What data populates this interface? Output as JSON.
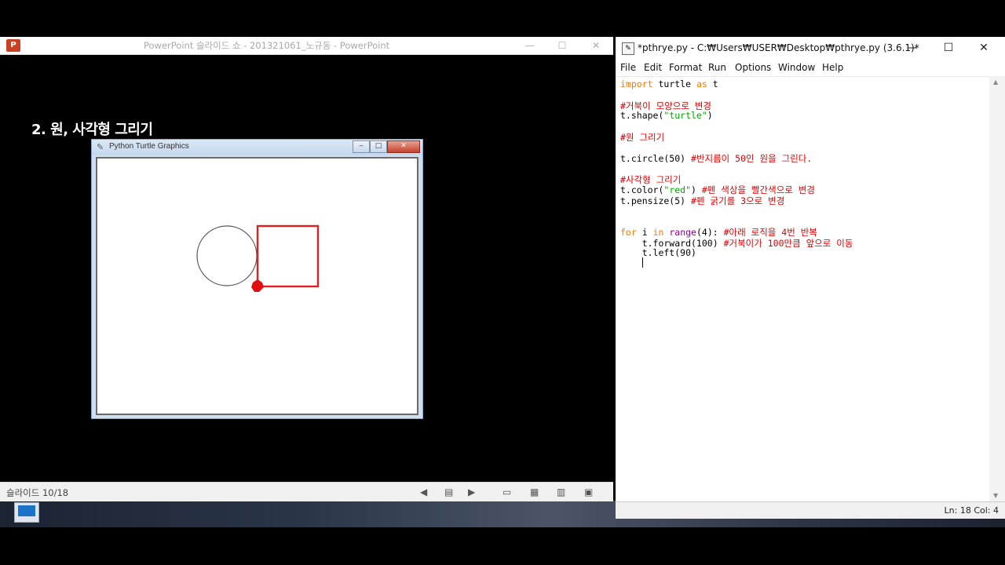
{
  "powerpoint": {
    "title": "PowerPoint 슬라이드 쇼  -  201321061_노규동 - PowerPoint",
    "logo": "P",
    "slide_heading": "2. 원, 사각형 그리기",
    "status": {
      "slide_count": "슬라이드 10/18"
    }
  },
  "turtle_window": {
    "title": "Python Turtle Graphics",
    "drawing": {
      "circle_color": "#555555",
      "square_color": "#ff0000",
      "turtle_color": "#ff0000"
    }
  },
  "idle": {
    "title": "*pthrye.py - C:₩Users₩USER₩Desktop₩pthrye.py (3.6.1)*",
    "menu": [
      "File",
      "Edit",
      "Format",
      "Run",
      "Options",
      "Window",
      "Help"
    ],
    "code": {
      "l1_kw1": "import",
      "l1_mid": " turtle ",
      "l1_kw2": "as",
      "l1_end": " t",
      "l3": "#거북이 모양으로 변경",
      "l4_a": "t.shape(",
      "l4_str": "\"turtle\"",
      "l4_b": ")",
      "l6": "#원 그리기",
      "l8_code": "t.circle(50) ",
      "l8_cm": "#반지름이 50인 원을 그린다.",
      "l10": "#사각형 그리기",
      "l11_a": "t.color(",
      "l11_str": "\"red\"",
      "l11_b": ") ",
      "l11_cm": "#펜 색상을 빨간색으로 변경",
      "l12_code": "t.pensize(5) ",
      "l12_cm": "#펜 굵기를 3으로 변경",
      "l15_kw1": "for",
      "l15_a": " i ",
      "l15_kw2": "in",
      "l15_b": " ",
      "l15_fn": "range",
      "l15_c": "(4): ",
      "l15_cm": "#아래 로직을 4번 반복",
      "l16_code": "    t.forward(100) ",
      "l16_cm": "#거북이가 100만큼 앞으로 이동",
      "l17": "    t.left(90)"
    },
    "status": {
      "position": "Ln: 18   Col: 4"
    }
  }
}
